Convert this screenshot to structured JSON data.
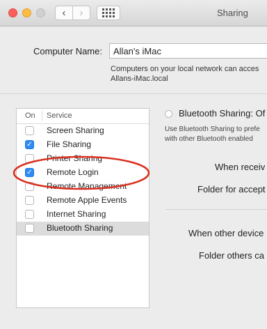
{
  "window": {
    "title": "Sharing"
  },
  "toolbar": {
    "back_icon": "‹",
    "forward_icon": "›"
  },
  "computer_name": {
    "label": "Computer Name:",
    "value": "Allan's iMac",
    "info_line1": "Computers on your local network can acces",
    "info_line2": "Allans-iMac.local"
  },
  "services": {
    "col_on": "On",
    "col_service": "Service",
    "checkmark": "✓",
    "items": [
      {
        "label": "Screen Sharing",
        "checked": false,
        "selected": false
      },
      {
        "label": "File Sharing",
        "checked": true,
        "selected": false
      },
      {
        "label": "Printer Sharing",
        "checked": false,
        "selected": false
      },
      {
        "label": "Remote Login",
        "checked": true,
        "selected": false
      },
      {
        "label": "Remote Management",
        "checked": false,
        "selected": false
      },
      {
        "label": "Remote Apple Events",
        "checked": false,
        "selected": false
      },
      {
        "label": "Internet Sharing",
        "checked": false,
        "selected": false
      },
      {
        "label": "Bluetooth Sharing",
        "checked": false,
        "selected": true
      }
    ]
  },
  "bluetooth_panel": {
    "status": "Bluetooth Sharing: Of",
    "desc_line1": "Use Bluetooth Sharing to prefe",
    "desc_line2": "with other Bluetooth enabled",
    "when_receiving": "When receiv",
    "folder_accepted": "Folder for accept",
    "when_other_devices": "When other device",
    "folder_others": "Folder others ca"
  },
  "colors": {
    "checkbox_accent": "#2f8bf3",
    "annotation_ring": "#d9301f",
    "selected_row": "#dcdcdc"
  }
}
